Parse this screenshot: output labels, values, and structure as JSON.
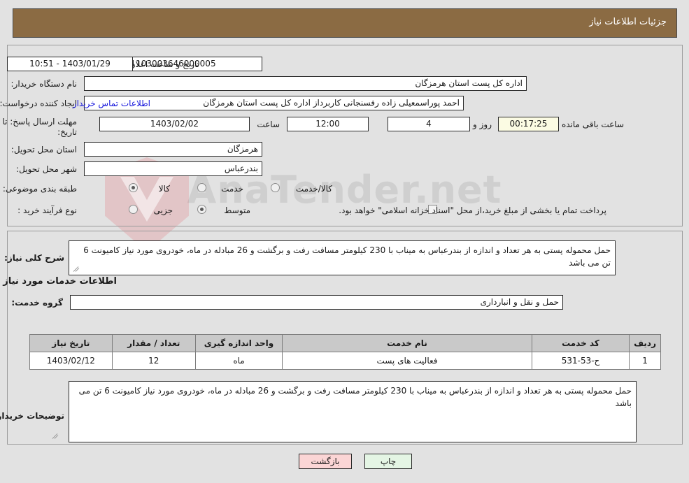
{
  "header": {
    "title": "جزئیات اطلاعات نیاز",
    "bar_color": "#8b6b43"
  },
  "watermark": {
    "text": "AnaTender.net"
  },
  "top_form": {
    "need_number_label": "شماره نیاز:",
    "need_number_value": "1103003646000005",
    "announce_datetime_label": "تاریخ و ساعت اعلان عمومی:",
    "announce_datetime_value": "1403/01/29 - 10:51",
    "buyer_org_label": "نام دستگاه خریدار:",
    "buyer_org_value": "اداره کل پست استان هرمزگان",
    "creator_label": "ایجاد کننده درخواست:",
    "creator_value": "احمد پوراسمعیلی زاده رفسنجانی کاربرداز اداره کل پست استان هرمزگان",
    "contact_link": "اطلاعات تماس خریدار",
    "deadline_label_line1": "مهلت ارسال پاسخ: تا",
    "deadline_label_line2": "تاریخ:",
    "deadline_date": "1403/02/02",
    "hour_label": "ساعت",
    "deadline_time": "12:00",
    "days_value": "4",
    "days_label": "روز و",
    "remaining_time": "00:17:25",
    "remaining_label": "ساعت باقی مانده",
    "province_label": "استان محل تحویل:",
    "province_value": "هرمزگان",
    "city_label": "شهر محل تحویل:",
    "city_value": "بندرعباس",
    "category_label": "طبقه بندی موضوعی:",
    "category_options": [
      {
        "label": "کالا",
        "selected": false
      },
      {
        "label": "خدمت",
        "selected": true
      },
      {
        "label": "کالا/خدمت",
        "selected": false
      }
    ],
    "process_label": "نوع فرآیند خرید :",
    "process_options": [
      {
        "label": "جزیی",
        "selected": false
      },
      {
        "label": "متوسط",
        "selected": true
      }
    ],
    "treasury_checkbox_label": "پرداخت تمام یا بخشی از مبلغ خرید،از محل \"اسناد خزانه اسلامی\" خواهد بود.",
    "treasury_checked": false
  },
  "bottom_form": {
    "need_description_label": "شرح کلی نیاز:",
    "need_description_value": "حمل محموله پستی به هر تعداد و اندازه از بندرعباس به میناب با 230 کیلومتر مسافت رفت و برگشت و 26 مبادله در ماه، خودروی مورد نیاز کامیونت 6 تن می باشد",
    "services_heading": "اطلاعات خدمات مورد نیاز",
    "service_group_label": "گروه خدمت:",
    "service_group_value": "حمل و نقل و انبارداری",
    "table": {
      "columns": [
        "ردیف",
        "کد خدمت",
        "نام خدمت",
        "واحد اندازه گیری",
        "تعداد / مقدار",
        "تاریخ نیاز"
      ],
      "rows": [
        {
          "row_no": "1",
          "service_code": "ح-53-531",
          "service_name": "فعالیت های پست",
          "unit": "ماه",
          "quantity": "12",
          "need_date": "1403/02/12"
        }
      ]
    },
    "buyer_notes_label": "توضیحات خریدار:",
    "buyer_notes_value": "حمل محموله پستی به هر تعداد و اندازه از بندرعباس به میناب با 230 کیلومتر مسافت رفت و برگشت و 26 مبادله در ماه، خودروی مورد نیاز کامیونت 6 تن می باشد"
  },
  "footer": {
    "print_label": "چاپ",
    "back_label": "بازگشت"
  }
}
